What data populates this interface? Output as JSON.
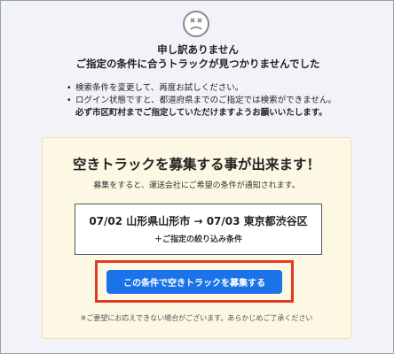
{
  "header": {
    "icon": "sad-face-icon",
    "title_line1": "申し訳ありません",
    "title_line2": "ご指定の条件に合うトラックが見つかりませんでした"
  },
  "tips": {
    "items": [
      "検索条件を変更して、再度お試しください。",
      "ログイン状態ですと、都道府県までのご指定では検索ができません。"
    ],
    "note": "必ず市区町村までご指定していただけますようお願いいたします。"
  },
  "panel": {
    "title": "空きトラックを募集する事が出来ます！",
    "description": "募集をすると、運送会社にご希望の条件が通知されます。",
    "route": "07/02 山形県山形市 → 07/03 東京都渋谷区",
    "route_sub": "＋ご指定の絞り込み条件",
    "button_label": "この条件で空きトラックを募集する",
    "footnote": "※ご要望にお応えできない場合がございます。あらかじめご了承ください"
  },
  "colors": {
    "background": "#f1f3f8",
    "panel_background": "#fcf8e4",
    "button": "#1a73e8",
    "highlight": "#e13a24"
  }
}
